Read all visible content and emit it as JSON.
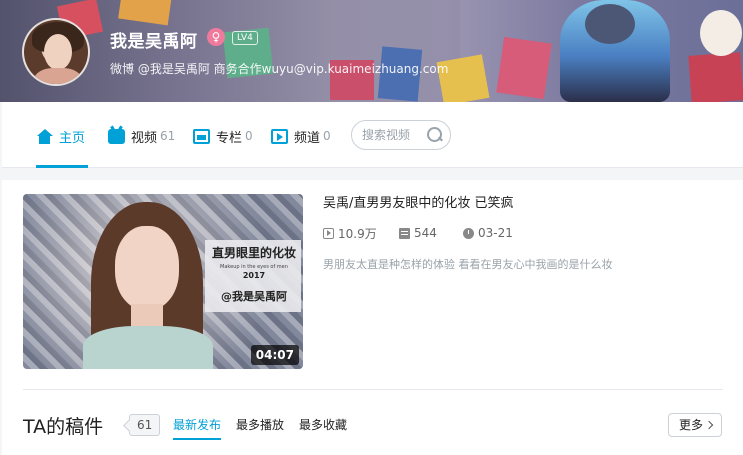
{
  "header": {
    "username": "我是吴禹阿",
    "gender_symbol": "♀",
    "level": "LV4",
    "sign": "微博 @我是吴禹阿 商务合作wuyu@vip.kuaimeizhuang.com"
  },
  "nav": {
    "items": [
      {
        "label": "主页",
        "count": ""
      },
      {
        "label": "视频",
        "count": "61"
      },
      {
        "label": "专栏",
        "count": "0"
      },
      {
        "label": "频道",
        "count": "0"
      }
    ],
    "search_placeholder": "搜索视频"
  },
  "featured": {
    "title": "吴禹/直男男友眼中的化妆 已笑疯",
    "plays": "10.9万",
    "danmaku": "544",
    "date": "03-21",
    "description": "男朋友太直是种怎样的体验 看看在男友心中我画的是什么妆",
    "duration": "04:07",
    "thumb_text": {
      "title": "直男眼里的化妆",
      "subtitle": "Makeup in the eyes of men",
      "year": "2017",
      "handle": "@我是吴禹阿"
    }
  },
  "works": {
    "title": "TA的稿件",
    "count": "61",
    "sorts": [
      "最新发布",
      "最多播放",
      "最多收藏"
    ],
    "more_label": "更多"
  },
  "colors": {
    "accent": "#00a1d6",
    "gender": "#f07a9c"
  }
}
